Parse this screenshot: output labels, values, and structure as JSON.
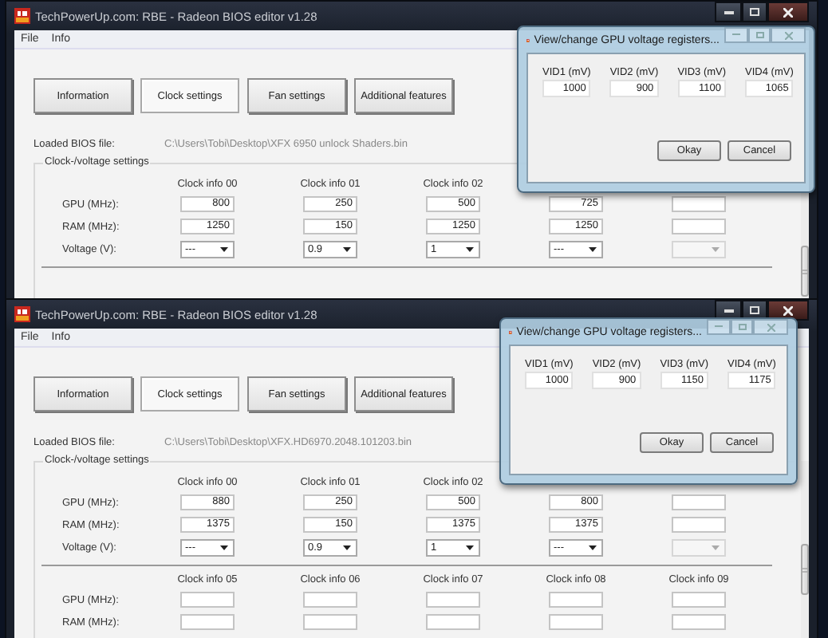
{
  "windows": [
    {
      "title": "TechPowerUp.com: RBE - Radeon BIOS editor v1.28",
      "menu": [
        "File",
        "Info"
      ],
      "tabs": [
        {
          "label": "Information",
          "selected": false
        },
        {
          "label": "Clock settings",
          "selected": true
        },
        {
          "label": "Fan settings",
          "selected": false
        },
        {
          "label": "Additional features",
          "selected": false
        }
      ],
      "loaded_label": "Loaded BIOS file:",
      "loaded_path": "C:\\Users\\Tobi\\Desktop\\XFX 6950 unlock Shaders.bin",
      "group_title": "Clock-/voltage settings",
      "blocks": [
        {
          "row_labels": [
            "GPU (MHz):",
            "RAM (MHz):",
            "Voltage (V):"
          ],
          "columns": [
            {
              "header": "Clock info 00",
              "cells": [
                {
                  "kind": "field",
                  "value": "800"
                },
                {
                  "kind": "field",
                  "value": "1250"
                },
                {
                  "kind": "dropdown",
                  "value": "---",
                  "disabled": false
                }
              ]
            },
            {
              "header": "Clock info 01",
              "cells": [
                {
                  "kind": "field",
                  "value": "250"
                },
                {
                  "kind": "field",
                  "value": "150"
                },
                {
                  "kind": "dropdown",
                  "value": "0.9",
                  "disabled": false
                }
              ]
            },
            {
              "header": "Clock info 02",
              "cells": [
                {
                  "kind": "field",
                  "value": "500"
                },
                {
                  "kind": "field",
                  "value": "1250"
                },
                {
                  "kind": "dropdown",
                  "value": "1",
                  "disabled": false
                }
              ]
            },
            {
              "cells": [
                {
                  "kind": "field",
                  "value": "725"
                },
                {
                  "kind": "field",
                  "value": "1250"
                },
                {
                  "kind": "dropdown",
                  "value": "---",
                  "disabled": false
                }
              ]
            },
            {
              "cells": [
                {
                  "kind": "field"
                },
                {
                  "kind": "field"
                },
                {
                  "kind": "dropdown",
                  "disabled": true
                }
              ]
            }
          ]
        }
      ],
      "dialog": {
        "title": "View/change GPU voltage registers...",
        "fields": [
          {
            "label": "VID1 (mV)",
            "value": "1000"
          },
          {
            "label": "VID2 (mV)",
            "value": "900"
          },
          {
            "label": "VID3 (mV)",
            "value": "1100"
          },
          {
            "label": "VID4 (mV)",
            "value": "1065"
          }
        ],
        "buttons": [
          "Okay",
          "Cancel"
        ]
      }
    },
    {
      "title": "TechPowerUp.com: RBE - Radeon BIOS editor v1.28",
      "menu": [
        "File",
        "Info"
      ],
      "tabs": [
        {
          "label": "Information",
          "selected": false
        },
        {
          "label": "Clock settings",
          "selected": true
        },
        {
          "label": "Fan settings",
          "selected": false
        },
        {
          "label": "Additional features",
          "selected": false
        }
      ],
      "loaded_label": "Loaded BIOS file:",
      "loaded_path": "C:\\Users\\Tobi\\Desktop\\XFX.HD6970.2048.101203.bin",
      "group_title": "Clock-/voltage settings",
      "blocks": [
        {
          "row_labels": [
            "GPU (MHz):",
            "RAM (MHz):",
            "Voltage (V):"
          ],
          "columns": [
            {
              "header": "Clock info 00",
              "cells": [
                {
                  "kind": "field",
                  "value": "880"
                },
                {
                  "kind": "field",
                  "value": "1375"
                },
                {
                  "kind": "dropdown",
                  "value": "---",
                  "disabled": false
                }
              ]
            },
            {
              "header": "Clock info 01",
              "cells": [
                {
                  "kind": "field",
                  "value": "250"
                },
                {
                  "kind": "field",
                  "value": "150"
                },
                {
                  "kind": "dropdown",
                  "value": "0.9",
                  "disabled": false
                }
              ]
            },
            {
              "header": "Clock info 02",
              "cells": [
                {
                  "kind": "field",
                  "value": "500"
                },
                {
                  "kind": "field",
                  "value": "1375"
                },
                {
                  "kind": "dropdown",
                  "value": "1",
                  "disabled": false
                }
              ]
            },
            {
              "cells": [
                {
                  "kind": "field",
                  "value": "800"
                },
                {
                  "kind": "field",
                  "value": "1375"
                },
                {
                  "kind": "dropdown",
                  "value": "---",
                  "disabled": false
                }
              ]
            },
            {
              "cells": [
                {
                  "kind": "field"
                },
                {
                  "kind": "field"
                },
                {
                  "kind": "dropdown",
                  "disabled": true
                }
              ]
            }
          ]
        },
        {
          "row_labels": [
            "GPU (MHz):",
            "RAM (MHz):"
          ],
          "columns": [
            {
              "header": "Clock info 05",
              "cells": [
                {
                  "kind": "field"
                },
                {
                  "kind": "field"
                }
              ]
            },
            {
              "header": "Clock info 06",
              "cells": [
                {
                  "kind": "field"
                },
                {
                  "kind": "field"
                }
              ]
            },
            {
              "header": "Clock info 07",
              "cells": [
                {
                  "kind": "field"
                },
                {
                  "kind": "field"
                }
              ]
            },
            {
              "header": "Clock info 08",
              "cells": [
                {
                  "kind": "field"
                },
                {
                  "kind": "field"
                }
              ]
            },
            {
              "header": "Clock info 09",
              "cells": [
                {
                  "kind": "field"
                },
                {
                  "kind": "field"
                }
              ]
            }
          ]
        }
      ],
      "dialog": {
        "title": "View/change GPU voltage registers...",
        "fields": [
          {
            "label": "VID1 (mV)",
            "value": "1000"
          },
          {
            "label": "VID2 (mV)",
            "value": "900"
          },
          {
            "label": "VID3 (mV)",
            "value": "1150"
          },
          {
            "label": "VID4 (mV)",
            "value": "1175"
          }
        ],
        "buttons": [
          "Okay",
          "Cancel"
        ]
      }
    }
  ]
}
